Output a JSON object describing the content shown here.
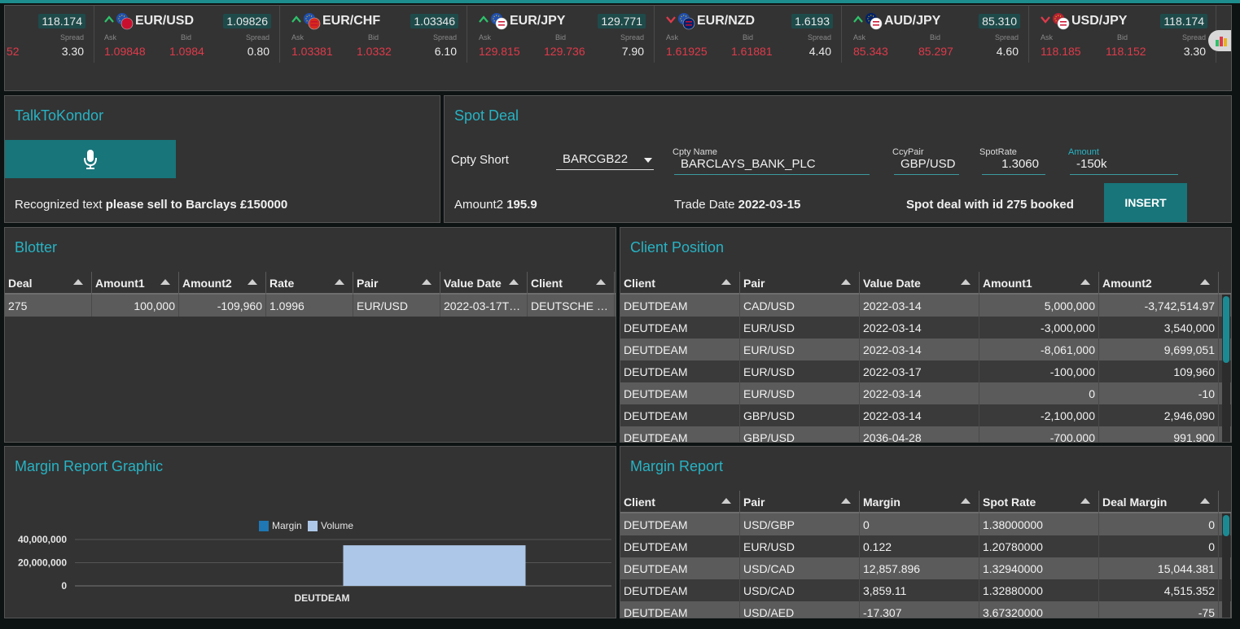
{
  "colors": {
    "accent": "#27b3c4",
    "button": "#18757a",
    "ask_bid": "#e03a4a",
    "bar_volume": "#adc7e8",
    "bar_margin": "#1f77b4"
  },
  "ticker": [
    {
      "pair": "",
      "direction": "",
      "flag": "",
      "rate": "118.174",
      "spread_label": "Spread",
      "ask": "",
      "bid": "52",
      "spread": "3.30"
    },
    {
      "pair": "EUR/USD",
      "direction": "up",
      "flag": "eu-us-flag",
      "rate": "1.09826",
      "ask_label": "Ask",
      "bid_label": "Bid",
      "spread_label": "Spread",
      "ask": "1.09848",
      "bid": "1.0984",
      "spread": "0.80"
    },
    {
      "pair": "EUR/CHF",
      "direction": "up",
      "flag": "eu-ch-flag",
      "rate": "1.03346",
      "ask_label": "Ask",
      "bid_label": "Bid",
      "spread_label": "Spread",
      "ask": "1.03381",
      "bid": "1.0332",
      "spread": "6.10"
    },
    {
      "pair": "EUR/JPY",
      "direction": "up",
      "flag": "eu-jp-flag",
      "rate": "129.771",
      "ask_label": "Ask",
      "bid_label": "Bid",
      "spread_label": "Spread",
      "ask": "129.815",
      "bid": "129.736",
      "spread": "7.90"
    },
    {
      "pair": "EUR/NZD",
      "direction": "down",
      "flag": "eu-nz-flag",
      "rate": "1.6193",
      "ask_label": "Ask",
      "bid_label": "Bid",
      "spread_label": "Spread",
      "ask": "1.61925",
      "bid": "1.61881",
      "spread": "4.40"
    },
    {
      "pair": "AUD/JPY",
      "direction": "up",
      "flag": "au-jp-flag",
      "rate": "85.310",
      "ask_label": "Ask",
      "bid_label": "Bid",
      "spread_label": "Spread",
      "ask": "85.343",
      "bid": "85.297",
      "spread": "4.60"
    },
    {
      "pair": "USD/JPY",
      "direction": "down",
      "flag": "us-jp-flag",
      "rate": "118.174",
      "ask_label": "Ask",
      "bid_label": "Bid",
      "spread_label": "Spread",
      "ask": "118.185",
      "bid": "118.152",
      "spread": "3.30"
    }
  ],
  "talk": {
    "title": "TalkToKondor",
    "mic_icon": "microphone-icon",
    "recognized_label": "Recognized text",
    "recognized_value": "please sell to Barclays £150000"
  },
  "spot": {
    "title": "Spot Deal",
    "cpty_short_label": "Cpty Short",
    "cpty_short_value": "BARCGB22",
    "cpty_name_label": "Cpty Name",
    "cpty_name_value": "BARCLAYS_BANK_PLC",
    "ccypair_label": "CcyPair",
    "ccypair_value": "GBP/USD",
    "spotrate_label": "SpotRate",
    "spotrate_value": "1.3060",
    "amount_label": "Amount",
    "amount_value": "-150k",
    "amount2_label": "Amount2",
    "amount2_value": "195.9",
    "trade_date_label": "Trade Date",
    "trade_date_value": "2022-03-15",
    "status": "Spot deal with id 275 booked",
    "insert_label": "INSERT"
  },
  "blotter": {
    "title": "Blotter",
    "columns": [
      "Deal",
      "Amount1",
      "Amount2",
      "Rate",
      "Pair",
      "Value Date",
      "Client"
    ],
    "rows": [
      [
        "275",
        "100,000",
        "-109,960",
        "1.0996",
        "EUR/USD",
        "2022-03-17T0...",
        "DEUTSCHE BA..."
      ]
    ]
  },
  "client_position": {
    "title": "Client Position",
    "columns": [
      "Client",
      "Pair",
      "Value Date",
      "Amount1",
      "Amount2"
    ],
    "rows": [
      [
        "DEUTDEAM",
        "CAD/USD",
        "2022-03-14",
        "5,000,000",
        "-3,742,514.97"
      ],
      [
        "DEUTDEAM",
        "EUR/USD",
        "2022-03-14",
        "-3,000,000",
        "3,540,000"
      ],
      [
        "DEUTDEAM",
        "EUR/USD",
        "2022-03-14",
        "-8,061,000",
        "9,699,051"
      ],
      [
        "DEUTDEAM",
        "EUR/USD",
        "2022-03-17",
        "-100,000",
        "109,960"
      ],
      [
        "DEUTDEAM",
        "EUR/USD",
        "2022-03-14",
        "0",
        "-10"
      ],
      [
        "DEUTDEAM",
        "GBP/USD",
        "2022-03-14",
        "-2,100,000",
        "2,946,090"
      ],
      [
        "DEUTDEAM",
        "GBP/USD",
        "2036-04-28",
        "-700,000",
        "991,900"
      ]
    ]
  },
  "margin_graphic": {
    "title": "Margin Report Graphic"
  },
  "chart_data": {
    "type": "bar",
    "categories": [
      "DEUTDEAM"
    ],
    "series": [
      {
        "name": "Margin",
        "values": [
          0
        ]
      },
      {
        "name": "Volume",
        "values": [
          35000000
        ]
      }
    ],
    "ytick_labels": [
      "0",
      "20,000,000",
      "40,000,000"
    ],
    "yticks": [
      0,
      20000000,
      40000000
    ],
    "ylim": [
      0,
      40000000
    ],
    "legend": "top-center",
    "grid": true
  },
  "margin_report": {
    "title": "Margin Report",
    "columns": [
      "Client",
      "Pair",
      "Margin",
      "Spot Rate",
      "Deal Margin"
    ],
    "rows": [
      [
        "DEUTDEAM",
        "USD/GBP",
        "0",
        "1.38000000",
        "0"
      ],
      [
        "DEUTDEAM",
        "EUR/USD",
        "0.122",
        "1.20780000",
        "0"
      ],
      [
        "DEUTDEAM",
        "USD/CAD",
        "12,857.896",
        "1.32940000",
        "15,044.381"
      ],
      [
        "DEUTDEAM",
        "USD/CAD",
        "3,859.11",
        "1.32880000",
        "4,515.352"
      ],
      [
        "DEUTDEAM",
        "USD/AED",
        "-17.307",
        "3.67320000",
        "-75"
      ]
    ]
  }
}
